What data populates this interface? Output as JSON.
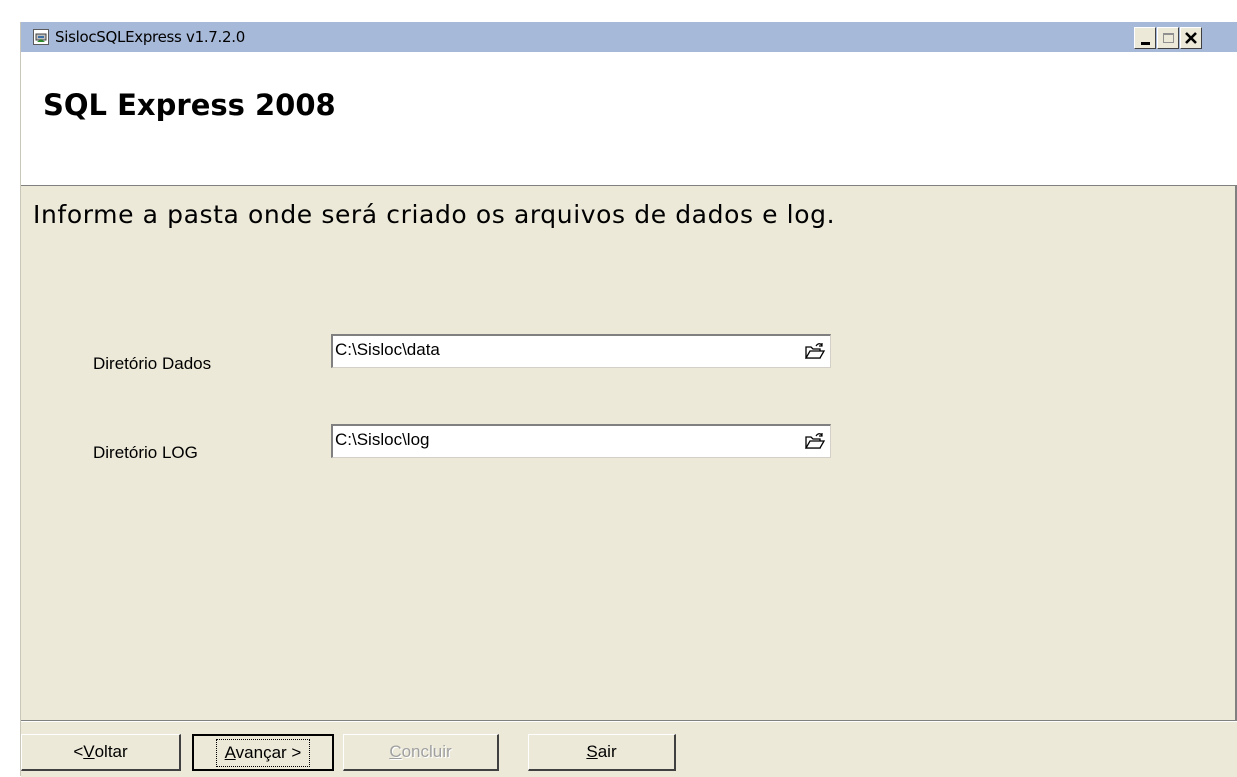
{
  "window": {
    "title": "SislocSQLExpress v1.7.2.0",
    "icon": "installer-app-icon"
  },
  "header": {
    "title": "SQL Express 2008"
  },
  "content": {
    "instruction": "Informe a pasta onde será criado os arquivos de dados e log.",
    "fields": [
      {
        "label": "Diretório Dados",
        "value": "C:\\Sisloc\\data",
        "button_icon": "folder-open-icon"
      },
      {
        "label": "Diretório LOG",
        "value": "C:\\Sisloc\\log",
        "button_icon": "folder-open-icon"
      }
    ]
  },
  "footer": {
    "back_prefix": "< ",
    "back_mnemonic": "V",
    "back_rest": "oltar",
    "next_mnemonic": "A",
    "next_rest": "vançar >",
    "finish_mnemonic": "C",
    "finish_rest": "oncluir",
    "exit_mnemonic": "S",
    "exit_rest": "air"
  },
  "colors": {
    "titlebar": "#a7b9d8",
    "dialog_face": "#ECE9D8",
    "header_bg": "#ffffff"
  }
}
